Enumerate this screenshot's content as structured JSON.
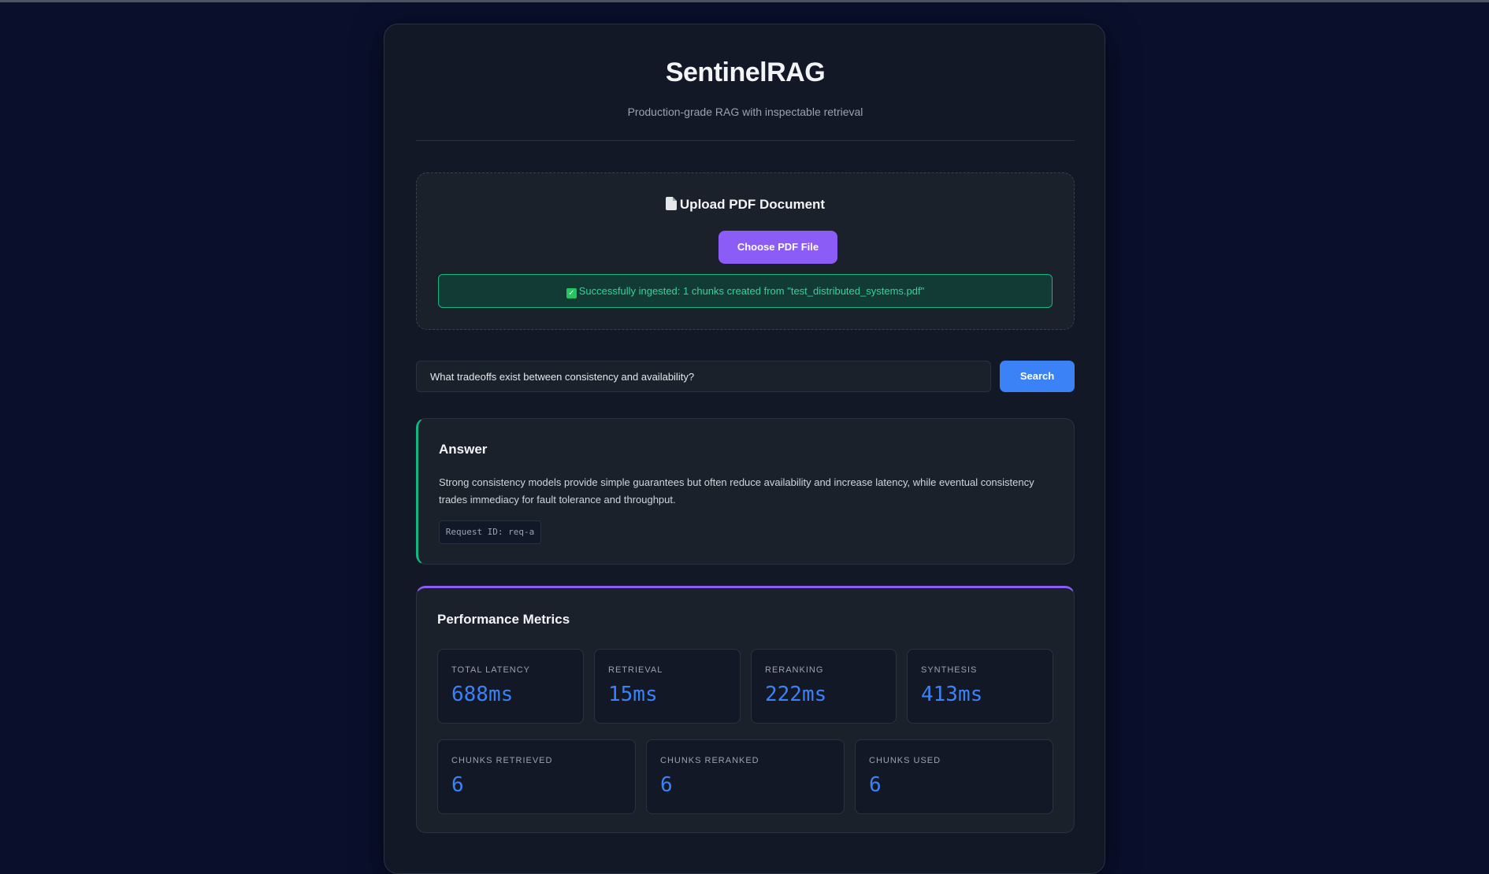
{
  "app": {
    "title": "SentinelRAG",
    "subtitle": "Production-grade RAG with inspectable retrieval"
  },
  "upload": {
    "icon": "document-icon",
    "title": "Upload PDF Document",
    "button_label": "Choose PDF File",
    "status_icon": "check-icon",
    "status_message": "Successfully ingested: 1 chunks created from \"test_distributed_systems.pdf\""
  },
  "search": {
    "query": "What tradeoffs exist between consistency and availability?",
    "button_label": "Search"
  },
  "answer": {
    "title": "Answer",
    "text": "Strong consistency models provide simple guarantees but often reduce availability and increase latency, while eventual consistency trades immediacy for fault tolerance and throughput.",
    "request_id": "Request ID: req-a"
  },
  "metrics": {
    "title": "Performance Metrics",
    "row1": [
      {
        "label": "TOTAL LATENCY",
        "value": "688ms"
      },
      {
        "label": "RETRIEVAL",
        "value": "15ms"
      },
      {
        "label": "RERANKING",
        "value": "222ms"
      },
      {
        "label": "SYNTHESIS",
        "value": "413ms"
      }
    ],
    "row2": [
      {
        "label": "CHUNKS RETRIEVED",
        "value": "6"
      },
      {
        "label": "CHUNKS RERANKED",
        "value": "6"
      },
      {
        "label": "CHUNKS USED",
        "value": "6"
      }
    ]
  },
  "colors": {
    "background": "#0a0f2c",
    "card": "#121826",
    "accent_purple": "#8b5cf6",
    "accent_blue": "#3b82f6",
    "success_green": "#10b981"
  }
}
